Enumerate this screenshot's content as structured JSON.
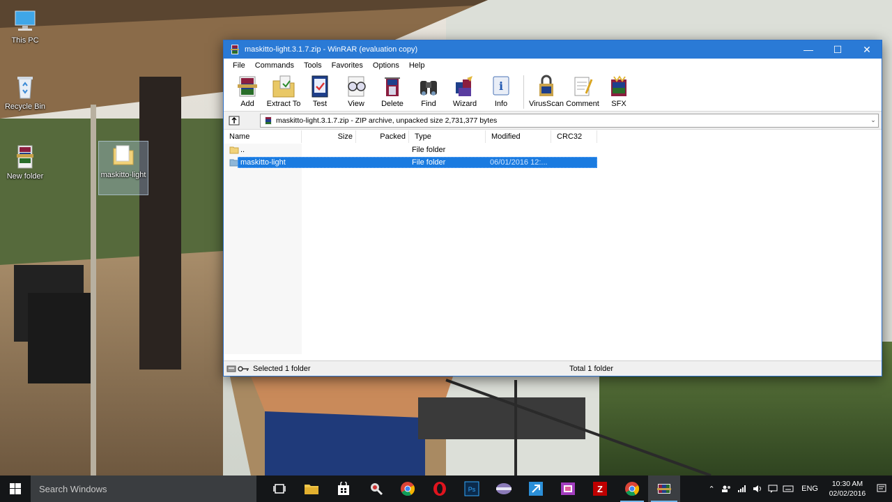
{
  "desktop": {
    "icons": [
      {
        "label": "This PC"
      },
      {
        "label": "Recycle Bin"
      },
      {
        "label": "New folder"
      },
      {
        "label": "maskitto-light"
      }
    ]
  },
  "window": {
    "title": "maskitto-light.3.1.7.zip - WinRAR (evaluation copy)",
    "controls": {
      "minimize": "—",
      "maximize": "☐",
      "close": "✕"
    },
    "menu": [
      "File",
      "Commands",
      "Tools",
      "Favorites",
      "Options",
      "Help"
    ],
    "toolbar": [
      "Add",
      "Extract To",
      "Test",
      "View",
      "Delete",
      "Find",
      "Wizard",
      "Info",
      "VirusScan",
      "Comment",
      "SFX"
    ],
    "address": {
      "path": "maskitto-light.3.1.7.zip - ZIP archive, unpacked size 2,731,377 bytes",
      "dropdown": "⌄"
    },
    "columns": {
      "name": "Name",
      "size": "Size",
      "packed": "Packed",
      "type": "Type",
      "modified": "Modified",
      "crc": "CRC32"
    },
    "rows": [
      {
        "name": "..",
        "size": "",
        "packed": "",
        "type": "File folder",
        "modified": ""
      },
      {
        "name": "maskitto-light",
        "size": "",
        "packed": "",
        "type": "File folder",
        "modified": "06/01/2016 12:..."
      }
    ],
    "status": {
      "left": "Selected 1 folder",
      "right": "Total 1 folder"
    }
  },
  "taskbar": {
    "search_placeholder": "Search Windows",
    "tray": {
      "arrow": "⌃",
      "lang": "ENG",
      "time": "10:30 AM",
      "date": "02/02/2016"
    }
  },
  "colors": {
    "titlebar": "#2a7ad6",
    "selection": "#1a7be0",
    "taskbar": "#141618"
  }
}
